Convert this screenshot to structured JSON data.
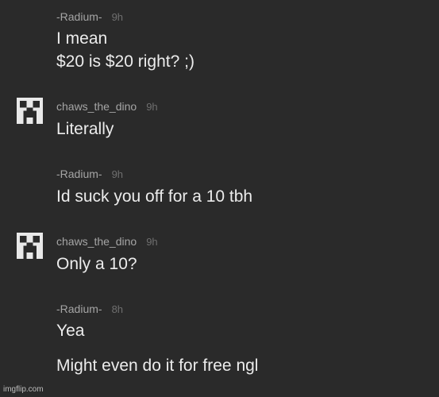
{
  "messages": [
    {
      "author": "-Radium-",
      "time": "9h",
      "avatar": null,
      "lines": [
        "I mean",
        "$20 is $20 right? ;)"
      ]
    },
    {
      "author": "chaws_the_dino",
      "time": "9h",
      "avatar": "creeper-face-icon",
      "lines": [
        "Literally"
      ]
    },
    {
      "author": "-Radium-",
      "time": "9h",
      "avatar": null,
      "lines": [
        "Id suck you off for a 10 tbh"
      ]
    },
    {
      "author": "chaws_the_dino",
      "time": "9h",
      "avatar": "creeper-face-icon",
      "lines": [
        "Only a 10?"
      ]
    },
    {
      "author": "-Radium-",
      "time": "8h",
      "avatar": null,
      "lines": [
        "Yea",
        "Might even do it for free ngl"
      ]
    }
  ],
  "watermark": "imgflip.com",
  "colors": {
    "background": "#2a2a2a",
    "author": "#a5a5a5",
    "timestamp": "#6f6f6f",
    "message": "#ececec"
  }
}
